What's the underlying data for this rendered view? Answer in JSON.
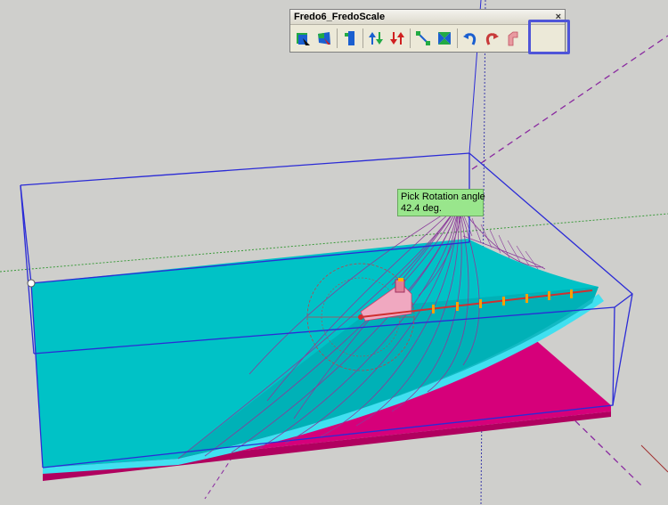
{
  "toolbar": {
    "title": "Fredo6_FredoScale",
    "close_label": "×",
    "buttons": [
      {
        "name": "box-scale-button",
        "icon": "box-scale-icon"
      },
      {
        "name": "tapered-scale-button",
        "icon": "tapered-scale-icon"
      },
      {
        "name": "stretch-button",
        "icon": "stretch-icon"
      },
      {
        "name": "twist-button",
        "icon": "twist-icon"
      },
      {
        "name": "plane-shear-button",
        "icon": "plane-shear-icon"
      },
      {
        "name": "radial-bend-button",
        "icon": "radial-bend-icon"
      },
      {
        "name": "bend-button",
        "icon": "bend-icon"
      },
      {
        "name": "undo-button",
        "icon": "undo-icon"
      },
      {
        "name": "redo-button",
        "icon": "redo-icon"
      },
      {
        "name": "rotate-pick-button",
        "icon": "rotate-pick-icon"
      }
    ],
    "highlighted_button": "rotate-pick-button"
  },
  "tooltip": {
    "line1": "Pick Rotation angle",
    "line2": "42.4 deg."
  },
  "colors": {
    "background": "#cfcfcc",
    "surface": "#00c2c6",
    "base": "#d6007a",
    "bounding_box": "#2b2bd6",
    "guide_lines": "#8a2aa0",
    "highlight": "#4f55d8",
    "tooltip_bg": "#99e68c"
  }
}
